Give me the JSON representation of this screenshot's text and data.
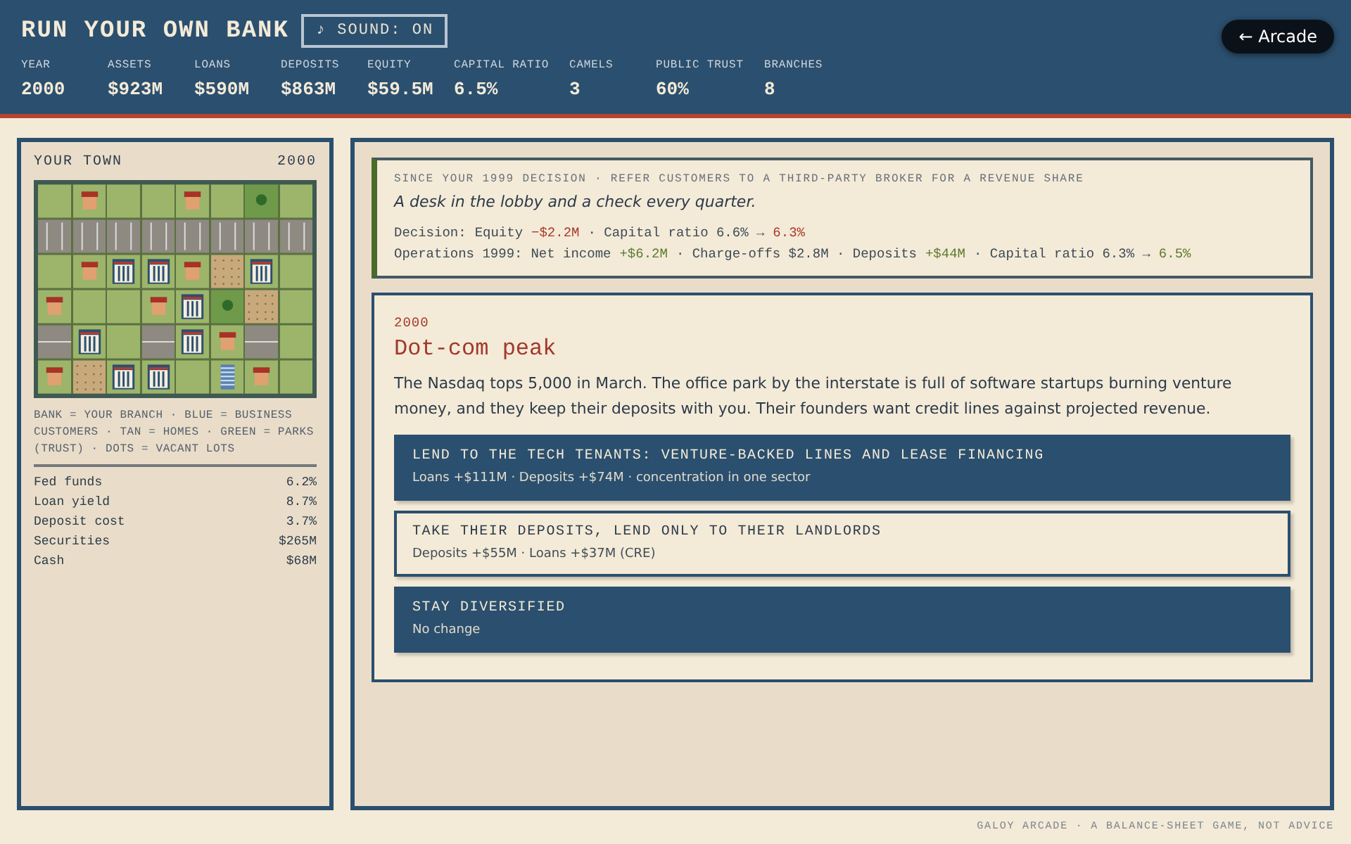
{
  "header": {
    "title": "RUN YOUR OWN BANK",
    "sound_button": "♪ SOUND: ON",
    "arcade_button": "← Arcade",
    "stats": [
      {
        "label": "YEAR",
        "value": "2000"
      },
      {
        "label": "ASSETS",
        "value": "$923M"
      },
      {
        "label": "LOANS",
        "value": "$590M"
      },
      {
        "label": "DEPOSITS",
        "value": "$863M"
      },
      {
        "label": "EQUITY",
        "value": "$59.5M"
      },
      {
        "label": "CAPITAL RATIO",
        "value": "6.5%"
      },
      {
        "label": "CAMELS",
        "value": "3"
      },
      {
        "label": "PUBLIC TRUST",
        "value": "60%"
      },
      {
        "label": "BRANCHES",
        "value": "8"
      }
    ]
  },
  "town": {
    "title": "YOUR TOWN",
    "year": "2000",
    "tiles": [
      [
        {
          "kind": "grass"
        },
        {
          "kind": "home"
        },
        {
          "kind": "grass"
        },
        {
          "kind": "grass"
        },
        {
          "kind": "home"
        },
        {
          "kind": "grass"
        },
        {
          "kind": "park"
        },
        {
          "kind": "grass"
        }
      ],
      [
        {
          "kind": "crosswalk"
        },
        {
          "kind": "crosswalk"
        },
        {
          "kind": "crosswalk"
        },
        {
          "kind": "crosswalk"
        },
        {
          "kind": "crosswalk"
        },
        {
          "kind": "crosswalk"
        },
        {
          "kind": "crosswalk"
        },
        {
          "kind": "crosswalk"
        }
      ],
      [
        {
          "kind": "grass"
        },
        {
          "kind": "home"
        },
        {
          "kind": "bank"
        },
        {
          "kind": "bank"
        },
        {
          "kind": "home"
        },
        {
          "kind": "vacant"
        },
        {
          "kind": "bank"
        },
        {
          "kind": "grass"
        }
      ],
      [
        {
          "kind": "home"
        },
        {
          "kind": "grass"
        },
        {
          "kind": "grass"
        },
        {
          "kind": "home"
        },
        {
          "kind": "bank"
        },
        {
          "kind": "park"
        },
        {
          "kind": "vacant"
        },
        {
          "kind": "grass"
        }
      ],
      [
        {
          "kind": "road"
        },
        {
          "kind": "bank"
        },
        {
          "kind": "grass"
        },
        {
          "kind": "road"
        },
        {
          "kind": "bank"
        },
        {
          "kind": "home"
        },
        {
          "kind": "road"
        },
        {
          "kind": "grass"
        }
      ],
      [
        {
          "kind": "home"
        },
        {
          "kind": "vacant"
        },
        {
          "kind": "bank"
        },
        {
          "kind": "bank"
        },
        {
          "kind": "grass"
        },
        {
          "kind": "business"
        },
        {
          "kind": "home"
        },
        {
          "kind": "grass"
        }
      ]
    ],
    "legend": "BANK = YOUR BRANCH · BLUE = BUSINESS CUSTOMERS · TAN = HOMES · GREEN = PARKS (TRUST) · DOTS = VACANT LOTS",
    "rates": [
      {
        "label": "Fed funds",
        "value": "6.2%"
      },
      {
        "label": "Loan yield",
        "value": "8.7%"
      },
      {
        "label": "Deposit cost",
        "value": "3.7%"
      },
      {
        "label": "Securities",
        "value": "$265M"
      },
      {
        "label": "Cash",
        "value": "$68M"
      }
    ]
  },
  "recap": {
    "heading": "SINCE YOUR 1999 DECISION · REFER CUSTOMERS TO A THIRD-PARTY BROKER FOR A REVENUE SHARE",
    "quote": "A desk in the lobby and a check every quarter.",
    "lines": [
      [
        {
          "text": "Decision:",
          "kind": "plain"
        },
        {
          "text": "Equity",
          "kind": "plain"
        },
        {
          "text": "−$2.2M",
          "kind": "loss"
        },
        {
          "text": "· Capital ratio 6.6% →",
          "kind": "plain"
        },
        {
          "text": "6.3%",
          "kind": "loss"
        }
      ],
      [
        {
          "text": "Operations 1999:",
          "kind": "plain"
        },
        {
          "text": "Net income",
          "kind": "plain"
        },
        {
          "text": "+$6.2M",
          "kind": "gain"
        },
        {
          "text": "· Charge-offs $2.8M · Deposits",
          "kind": "plain"
        },
        {
          "text": "+$44M",
          "kind": "gain"
        },
        {
          "text": "· Capital ratio 6.3% →",
          "kind": "plain"
        },
        {
          "text": "6.5%",
          "kind": "gain"
        }
      ]
    ]
  },
  "event": {
    "year": "2000",
    "title": "Dot-com peak",
    "body": "The Nasdaq tops 5,000 in March. The office park by the interstate is full of software startups burning venture money, and they keep their deposits with you. Their founders want credit lines against projected revenue.",
    "choices": [
      {
        "title": "LEND TO THE TECH TENANTS: VENTURE-BACKED LINES AND LEASE FINANCING",
        "effect": "Loans +$111M · Deposits +$74M · concentration in one sector",
        "kind": "filled"
      },
      {
        "title": "TAKE THEIR DEPOSITS, LEND ONLY TO THEIR LANDLORDS",
        "effect": "Deposits +$55M · Loans +$37M (CRE)",
        "kind": "outline"
      },
      {
        "title": "STAY DIVERSIFIED",
        "effect": "No change",
        "kind": "filled"
      }
    ]
  },
  "footer": "GALOY ARCADE · A BALANCE-SHEET GAME, NOT ADVICE"
}
